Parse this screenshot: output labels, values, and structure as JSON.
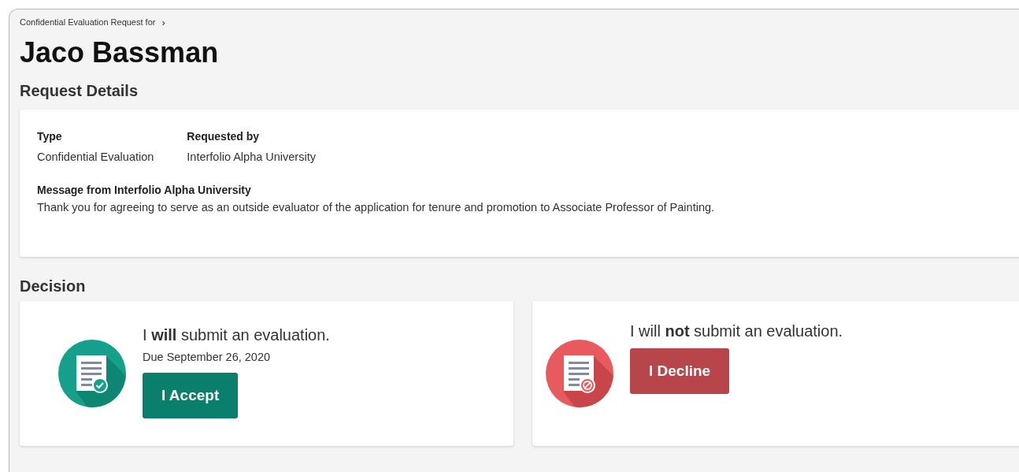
{
  "breadcrumb": {
    "label": "Confidential Evaluation Request for",
    "chevron": "›"
  },
  "title": "Jaco Bassman",
  "request_details": {
    "heading": "Request Details",
    "fields": [
      {
        "label": "Type",
        "value": "Confidential Evaluation"
      },
      {
        "label": "Requested by",
        "value": "Interfolio Alpha University"
      }
    ],
    "message": {
      "label": "Message from Interfolio Alpha University",
      "text": "Thank you for agreeing to serve as an outside evaluator of the application for tenure and promotion to Associate Professor of Painting."
    }
  },
  "decision": {
    "heading": "Decision",
    "options": [
      {
        "kind": "accept",
        "statement": "I **will** submit an evaluation.",
        "due": "Due September 26, 2020",
        "button": "I Accept"
      },
      {
        "kind": "decline",
        "statement": "I will **not** submit an evaluation.",
        "button": "I Decline"
      }
    ]
  }
}
